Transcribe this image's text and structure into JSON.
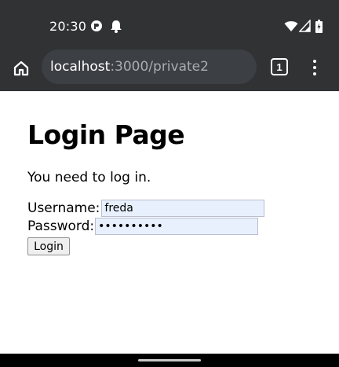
{
  "status_bar": {
    "time": "20:30",
    "icons": [
      "notification-app-icon",
      "notification-bell-icon",
      "wifi-icon",
      "signal-icon",
      "battery-icon"
    ]
  },
  "browser": {
    "url_host": "localhost",
    "url_path": ":3000/private2",
    "tab_count": "1"
  },
  "page": {
    "title": "Login Page",
    "intro": "You need to log in.",
    "username_label": "Username:",
    "username_value": "freda",
    "password_label": "Password:",
    "password_value": "••••••••••",
    "login_button": "Login"
  },
  "colors": {
    "chrome_bg": "#303234",
    "url_bar_bg": "#3c3f43",
    "autofill_bg": "#e8f0fe"
  }
}
